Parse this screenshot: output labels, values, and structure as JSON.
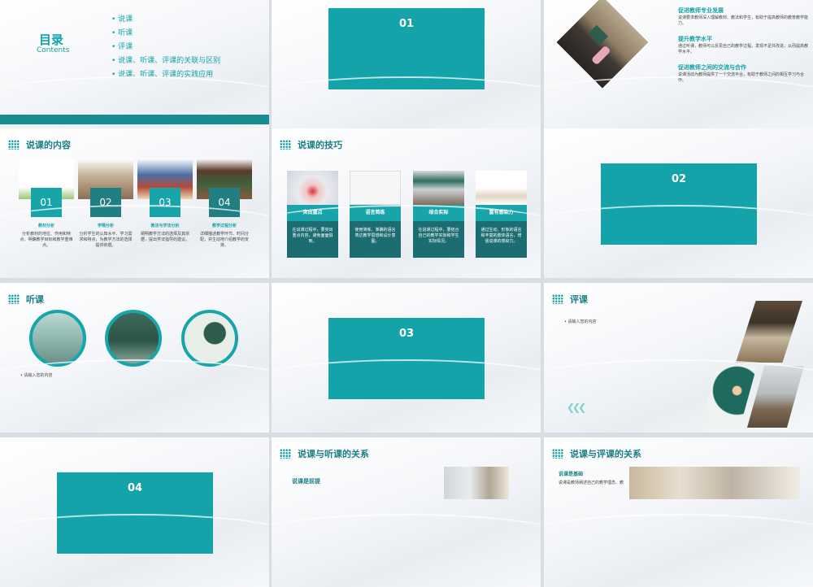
{
  "toc": {
    "title": "目录",
    "subtitle": "Contents",
    "items": [
      "说课",
      "听课",
      "评课",
      "说课、听课、评课的关联与区别",
      "说课、听课、评课的实践应用"
    ]
  },
  "section_numbers": [
    "01",
    "02",
    "03",
    "04"
  ],
  "benefits": [
    {
      "title": "促进教师专业发展",
      "text": "说课要求教师深入理解教材、教法和学生，有助于提高教师的教育教学能力。"
    },
    {
      "title": "提升教学水平",
      "text": "通过听课，教师可以反思自己的教学过程，发现不足并改进，从而提高教学水平。"
    },
    {
      "title": "促进教师之间的交流与合作",
      "text": "说课活动为教师提供了一个交流平台，有助于教师之间的相互学习与合作。"
    }
  ],
  "shuoke_content": {
    "title": "说课的内容",
    "cards": [
      {
        "num": "01",
        "label": "教材分析",
        "text": "分析教材的地位、作用和特点，明确教学目标和教学重难点。"
      },
      {
        "num": "02",
        "label": "学情分析",
        "text": "分析学生的认知水平、学习需求和特点，为教学方法的选择提供依据。"
      },
      {
        "num": "03",
        "label": "教法与学法分析",
        "text": "阐明教学方法的选择及其依据，提出学法指导的建议。"
      },
      {
        "num": "04",
        "label": "教学过程分析",
        "text": "详细描述教学环节、时间分配，并生动地介绍教学的安排。"
      }
    ]
  },
  "shuoke_skills": {
    "title": "说课的技巧",
    "cards": [
      {
        "label": "突出重点",
        "text": "在说课过程中，要突出重点内容，避免面面俱到。"
      },
      {
        "label": "语言简练",
        "text": "使用简练、准确的语言表达教学思想和设计意图。"
      },
      {
        "label": "结合实际",
        "text": "在说课过程中，要结合自己的教学实际和学生实际情况。"
      },
      {
        "label": "富有感染力",
        "text": "通过生动、形象的语言和丰富的肢体语言，增强说课的感染力。"
      }
    ]
  },
  "tingke": {
    "title": "听课",
    "placeholder": "请输入您的内容"
  },
  "pingke": {
    "title": "评课",
    "placeholder": "请输入您的内容"
  },
  "relation_listen": {
    "title": "说课与听课的关系",
    "sub": "说课是前提"
  },
  "relation_eval": {
    "title": "说课与评课的关系",
    "sub": "说课是基础",
    "text": "说课是教师阐述自己的教学理念、教"
  },
  "colors": {
    "teal": "#14a3a8",
    "dark_teal": "#1a6b70",
    "bar": "#1a8a90"
  }
}
